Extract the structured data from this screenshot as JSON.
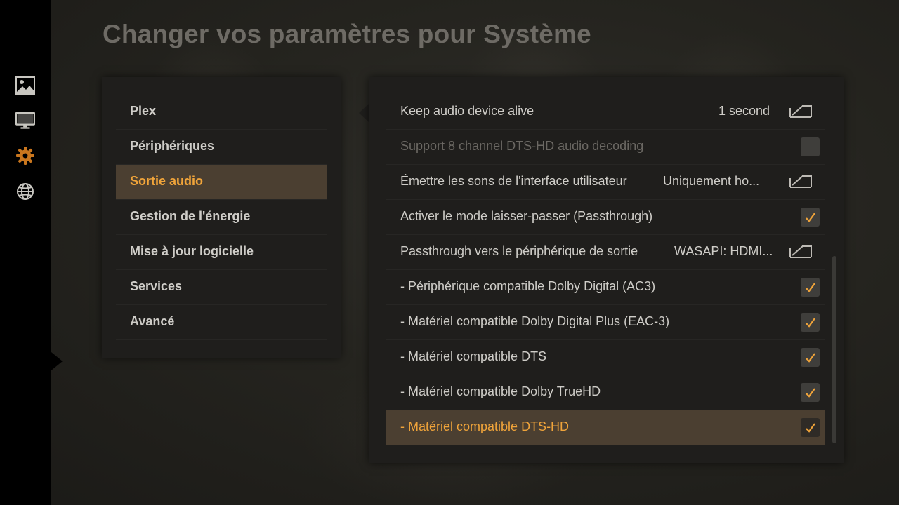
{
  "page": {
    "title": "Changer vos paramètres pour Système"
  },
  "sidebar": {
    "icons": [
      {
        "name": "photos-icon",
        "color": "#c8c6c0"
      },
      {
        "name": "monitor-icon",
        "color": "#c8c6c0"
      },
      {
        "name": "gear-icon",
        "color": "#c9761e",
        "active": true
      },
      {
        "name": "globe-icon",
        "color": "#c8c6c0"
      }
    ]
  },
  "categories": {
    "items": [
      {
        "label": "Plex"
      },
      {
        "label": "Périphériques"
      },
      {
        "label": "Sortie audio",
        "selected": true
      },
      {
        "label": "Gestion de l'énergie"
      },
      {
        "label": "Mise à jour logicielle"
      },
      {
        "label": "Services"
      },
      {
        "label": "Avancé"
      }
    ]
  },
  "settings": {
    "rows": [
      {
        "label": "Keep audio device alive",
        "type": "value",
        "value": "1 second"
      },
      {
        "label": "Support 8 channel DTS-HD audio decoding",
        "type": "checkbox",
        "checked": false,
        "disabled": true
      },
      {
        "label": "Émettre les sons de l'interface utilisateur",
        "type": "value",
        "value": "Uniquement ho..."
      },
      {
        "label": "Activer le mode laisser-passer (Passthrough)",
        "type": "checkbox",
        "checked": true
      },
      {
        "label": "Passthrough vers le périphérique de sortie",
        "type": "value",
        "value": "WASAPI: HDMI..."
      },
      {
        "label": "- Périphérique compatible Dolby Digital (AC3)",
        "type": "checkbox",
        "checked": true
      },
      {
        "label": "- Matériel compatible Dolby Digital Plus (EAC-3)",
        "type": "checkbox",
        "checked": true
      },
      {
        "label": "- Matériel compatible DTS",
        "type": "checkbox",
        "checked": true
      },
      {
        "label": "- Matériel compatible Dolby TrueHD",
        "type": "checkbox",
        "checked": true
      },
      {
        "label": "- Matériel compatible DTS-HD",
        "type": "checkbox",
        "checked": true,
        "selected": true
      }
    ]
  },
  "colors": {
    "accent": "#f0a43a",
    "selected_bg": "#4b3f31",
    "panel_bg": "#1f1e1c",
    "text": "#cfcdc8",
    "muted_text": "#6b6863",
    "title": "#6e6b65"
  }
}
